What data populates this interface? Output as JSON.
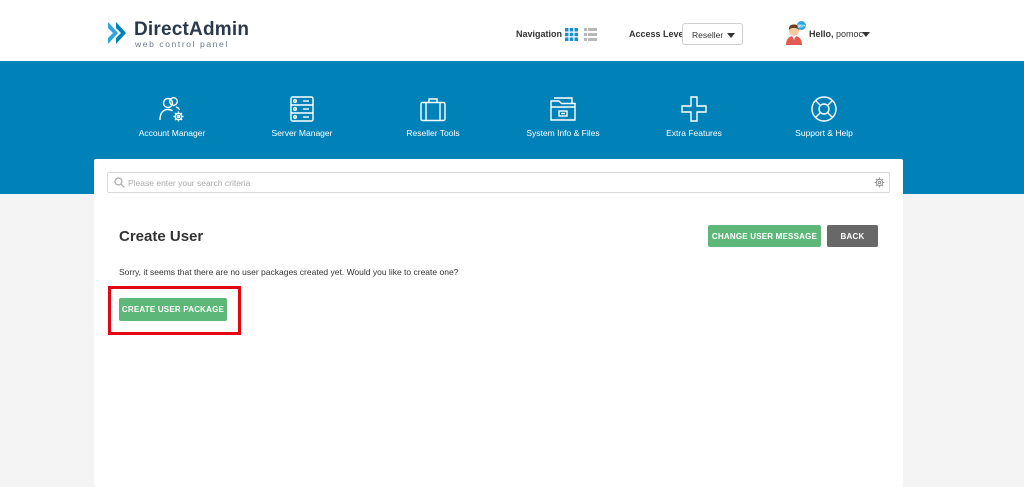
{
  "brand": {
    "title": "DirectAdmin",
    "subtitle": "web control panel",
    "colors": {
      "primary": "#0081b8",
      "accent": "#29a8e0",
      "dark": "#2a3a4d"
    }
  },
  "header": {
    "navigation_label": "Navigation",
    "view_icons": [
      "grid-view-icon",
      "list-view-icon"
    ],
    "access_level_label": "Access Level",
    "access_level_value": "Reseller",
    "greeting": "Hello,",
    "username": "pomoc",
    "avatar_badge": "99+"
  },
  "menu": [
    {
      "label": "Account Manager",
      "icon": "account-manager-icon"
    },
    {
      "label": "Server Manager",
      "icon": "server-manager-icon"
    },
    {
      "label": "Reseller Tools",
      "icon": "reseller-tools-icon"
    },
    {
      "label": "System Info & Files",
      "icon": "system-info-icon"
    },
    {
      "label": "Extra Features",
      "icon": "extra-features-icon"
    },
    {
      "label": "Support & Help",
      "icon": "support-help-icon"
    }
  ],
  "search": {
    "placeholder": "Please enter your search criteria",
    "value": ""
  },
  "content": {
    "title": "Create User",
    "change_message_button": "CHANGE USER MESSAGE",
    "back_button": "BACK",
    "message": "Sorry, it seems that there are no user packages created yet. Would you like to create one?",
    "create_package_button": "CREATE USER PACKAGE",
    "button_color": "#5cb778",
    "highlight_color": "#e30613"
  }
}
